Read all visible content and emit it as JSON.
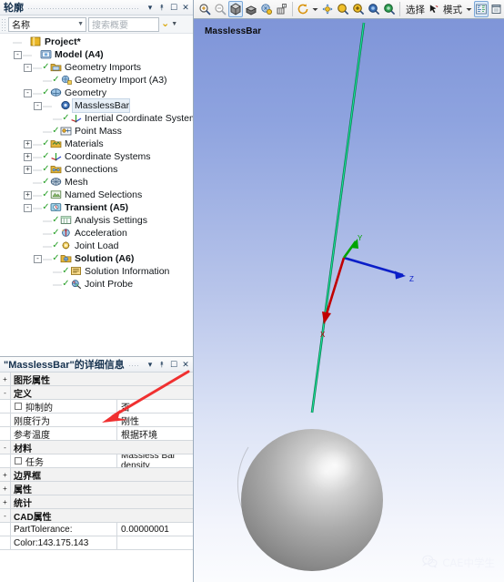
{
  "outline_panel": {
    "title": "轮廓",
    "caption_buttons": [
      "▾",
      "⯭",
      "☐",
      "✕"
    ],
    "filter": {
      "field_label": "名称",
      "search_placeholder": "搜索概要",
      "chevron": "⌄"
    },
    "tree": [
      {
        "label": "Project*",
        "depth": 0,
        "expander": "none",
        "tick": false,
        "bold": true,
        "icon": "project-folder-icon"
      },
      {
        "label": "Model (A4)",
        "depth": 1,
        "expander": "-",
        "tick": false,
        "bold": true,
        "icon": "model-icon"
      },
      {
        "label": "Geometry Imports",
        "depth": 2,
        "expander": "-",
        "tick": true,
        "bold": false,
        "icon": "geometry-imports-icon"
      },
      {
        "label": "Geometry Import (A3)",
        "depth": 3,
        "expander": "none",
        "tick": true,
        "bold": false,
        "icon": "geometry-import-icon"
      },
      {
        "label": "Geometry",
        "depth": 2,
        "expander": "-",
        "tick": true,
        "bold": false,
        "icon": "geometry-icon"
      },
      {
        "label": "MasslessBar",
        "depth": 3,
        "expander": "-",
        "tick": false,
        "bold": false,
        "icon": "body-icon",
        "selected": true
      },
      {
        "label": "Inertial Coordinate System",
        "depth": 4,
        "expander": "none",
        "tick": true,
        "bold": false,
        "icon": "coordinate-system-icon"
      },
      {
        "label": "Point Mass",
        "depth": 3,
        "expander": "none",
        "tick": true,
        "bold": false,
        "icon": "point-mass-icon"
      },
      {
        "label": "Materials",
        "depth": 2,
        "expander": "+",
        "tick": true,
        "bold": false,
        "icon": "materials-icon"
      },
      {
        "label": "Coordinate Systems",
        "depth": 2,
        "expander": "+",
        "tick": true,
        "bold": false,
        "icon": "coordinate-system-icon"
      },
      {
        "label": "Connections",
        "depth": 2,
        "expander": "+",
        "tick": true,
        "bold": false,
        "icon": "connections-icon"
      },
      {
        "label": "Mesh",
        "depth": 2,
        "expander": "none",
        "tick": true,
        "bold": false,
        "icon": "mesh-icon"
      },
      {
        "label": "Named Selections",
        "depth": 2,
        "expander": "+",
        "tick": true,
        "bold": false,
        "icon": "named-selections-icon"
      },
      {
        "label": "Transient (A5)",
        "depth": 2,
        "expander": "-",
        "tick": true,
        "bold": true,
        "icon": "transient-icon"
      },
      {
        "label": "Analysis Settings",
        "depth": 3,
        "expander": "none",
        "tick": true,
        "bold": false,
        "icon": "analysis-settings-icon"
      },
      {
        "label": "Acceleration",
        "depth": 3,
        "expander": "none",
        "tick": true,
        "bold": false,
        "icon": "acceleration-icon"
      },
      {
        "label": "Joint Load",
        "depth": 3,
        "expander": "none",
        "tick": true,
        "bold": false,
        "icon": "joint-load-icon"
      },
      {
        "label": "Solution (A6)",
        "depth": 3,
        "expander": "-",
        "tick": true,
        "bold": true,
        "icon": "solution-icon"
      },
      {
        "label": "Solution Information",
        "depth": 4,
        "expander": "none",
        "tick": true,
        "bold": false,
        "icon": "solution-information-icon"
      },
      {
        "label": "Joint Probe",
        "depth": 4,
        "expander": "none",
        "tick": true,
        "bold": false,
        "icon": "joint-probe-icon"
      }
    ]
  },
  "details_panel": {
    "title": "\"MasslessBar\"的详细信息",
    "caption_buttons": [
      "▾",
      "⯭",
      "☐",
      "✕"
    ],
    "rows": [
      {
        "kind": "group",
        "expander": "+",
        "name": "图形属性"
      },
      {
        "kind": "group",
        "expander": "-",
        "name": "定义"
      },
      {
        "kind": "item",
        "checkbox": true,
        "name": "抑制的",
        "value": "否"
      },
      {
        "kind": "item",
        "checkbox": false,
        "name": "刚度行为",
        "value": "刚性"
      },
      {
        "kind": "item",
        "checkbox": false,
        "name": "参考温度",
        "value": "根据环境"
      },
      {
        "kind": "group",
        "expander": "-",
        "name": "材料"
      },
      {
        "kind": "item",
        "checkbox": true,
        "name": "任务",
        "value": "Massless Bar density"
      },
      {
        "kind": "group",
        "expander": "+",
        "name": "边界框"
      },
      {
        "kind": "group",
        "expander": "+",
        "name": "属性"
      },
      {
        "kind": "group",
        "expander": "+",
        "name": "统计"
      },
      {
        "kind": "group",
        "expander": "-",
        "name": "CAD属性"
      },
      {
        "kind": "item",
        "checkbox": false,
        "name": "PartTolerance:",
        "value": "0.00000001"
      },
      {
        "kind": "item",
        "checkbox": false,
        "name": "Color:143.175.143",
        "value": ""
      }
    ],
    "annotation_arrow": {
      "color": "#f03030",
      "points_at": "刚度行为"
    }
  },
  "toolbar": {
    "items": [
      {
        "icon": "zoom-in-icon",
        "type": "icon",
        "active": false
      },
      {
        "icon": "zoom-out-icon",
        "type": "icon",
        "active": false
      },
      {
        "icon": "shaded-body-icon",
        "type": "icon",
        "active": true
      },
      {
        "icon": "wireframe-body-icon",
        "type": "icon",
        "active": false
      },
      {
        "icon": "show-mesh-icon",
        "type": "icon",
        "active": false
      },
      {
        "icon": "thicken-shells-icon",
        "type": "icon",
        "active": false
      },
      {
        "icon": "rotate-icon",
        "type": "icon",
        "active": false
      },
      {
        "icon": "rotate-dropdown-icon",
        "type": "caret",
        "active": false
      },
      {
        "icon": "pan-icon",
        "type": "icon",
        "active": false
      },
      {
        "icon": "zoom-icon",
        "type": "icon",
        "active": false
      },
      {
        "icon": "box-zoom-icon",
        "type": "icon",
        "active": false
      },
      {
        "icon": "zoom-to-fit-icon",
        "type": "icon",
        "active": false
      },
      {
        "icon": "magnifier-icon",
        "type": "icon",
        "active": false
      }
    ],
    "select_label": "选择",
    "cursor_icon": "select-cursor-icon",
    "mode_label": "模式",
    "mode_caret": "▾",
    "extra_icons": [
      {
        "icon": "selection-filter-icon",
        "active": true
      },
      {
        "icon": "new-window-icon",
        "active": false
      }
    ]
  },
  "viewport": {
    "label": "MasslessBar",
    "background_top": "#7f95d8",
    "background_bottom": "#fbfcfe",
    "bar": {
      "name": "massless-bar",
      "color": "#12d08a",
      "outline_color": "#0f7a4d"
    },
    "sphere": {
      "name": "point-mass-sphere",
      "color": "#a8a8a8"
    },
    "triad": {
      "x_axis": {
        "label": "X",
        "color": "#c10000"
      },
      "y_axis": {
        "label": "Y",
        "color": "#00a400"
      },
      "z_axis": {
        "label": "Z",
        "color": "#0b1ec8"
      }
    }
  },
  "watermark": {
    "icon": "wechat-icon",
    "text": "CAE中学生"
  }
}
